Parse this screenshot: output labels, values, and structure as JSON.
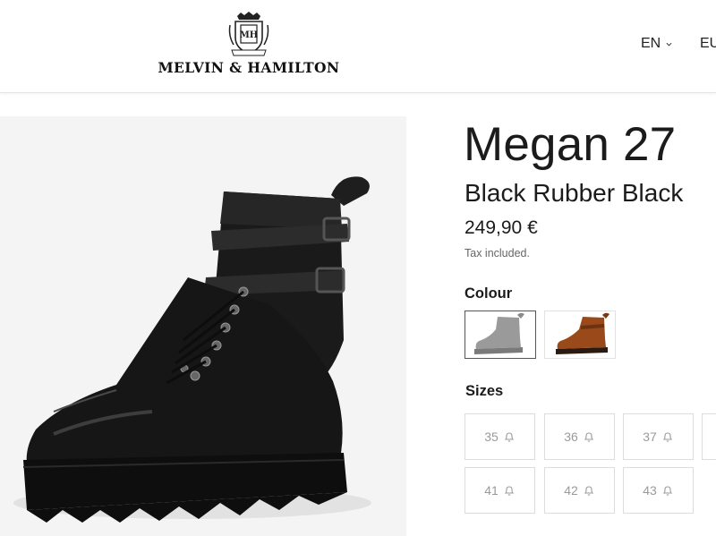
{
  "header": {
    "brand": "MELVIN & HAMILTON",
    "logo_icon": "crest-logo",
    "language": "EN",
    "currency": "EU"
  },
  "product": {
    "name": "Megan 27",
    "colour_name": "Black Rubber Black",
    "price": "249,90 €",
    "tax_note": "Tax included."
  },
  "colour": {
    "label": "Colour",
    "options": [
      {
        "name": "black",
        "selected": true
      },
      {
        "name": "cognac",
        "selected": false
      }
    ]
  },
  "sizes": {
    "label": "Sizes",
    "items": [
      {
        "size": "35",
        "icon": "bell-icon"
      },
      {
        "size": "36",
        "icon": "bell-icon"
      },
      {
        "size": "37",
        "icon": "bell-icon"
      },
      {
        "size": "41",
        "icon": "bell-icon"
      },
      {
        "size": "42",
        "icon": "bell-icon"
      },
      {
        "size": "43",
        "icon": "bell-icon"
      }
    ]
  },
  "colors": {
    "boot_black": "#151515",
    "boot_cognac": "#8a3f17",
    "image_bg": "#f4f4f4",
    "muted_text": "#9a9a9a"
  }
}
